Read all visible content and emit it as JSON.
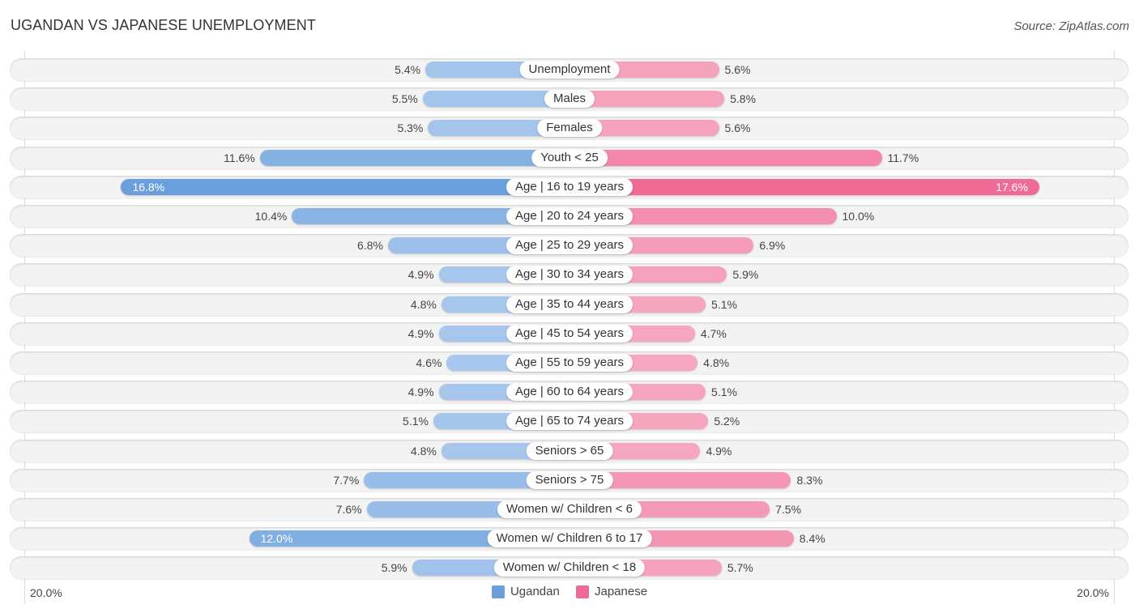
{
  "header": {
    "title": "UGANDAN VS JAPANESE UNEMPLOYMENT",
    "source": "Source: ZipAtlas.com"
  },
  "colors": {
    "ugandan_strong": "#6a9fdb",
    "ugandan_light": "#a8c7ec",
    "japanese_strong": "#f06a96",
    "japanese_light": "#f6a8c0"
  },
  "chart_data": {
    "type": "bar",
    "orientation": "horizontal-diverging",
    "title": "UGANDAN VS JAPANESE UNEMPLOYMENT",
    "xlim": [
      0,
      20.0
    ],
    "axis_labels": {
      "left": "20.0%",
      "right": "20.0%"
    },
    "legend": {
      "position": "bottom-center",
      "entries": [
        "Ugandan",
        "Japanese"
      ]
    },
    "categories": [
      "Unemployment",
      "Males",
      "Females",
      "Youth < 25",
      "Age | 16 to 19 years",
      "Age | 20 to 24 years",
      "Age | 25 to 29 years",
      "Age | 30 to 34 years",
      "Age | 35 to 44 years",
      "Age | 45 to 54 years",
      "Age | 55 to 59 years",
      "Age | 60 to 64 years",
      "Age | 65 to 74 years",
      "Seniors > 65",
      "Seniors > 75",
      "Women w/ Children < 6",
      "Women w/ Children 6 to 17",
      "Women w/ Children < 18"
    ],
    "series": [
      {
        "name": "Ugandan",
        "values": [
          5.4,
          5.5,
          5.3,
          11.6,
          16.8,
          10.4,
          6.8,
          4.9,
          4.8,
          4.9,
          4.6,
          4.9,
          5.1,
          4.8,
          7.7,
          7.6,
          12.0,
          5.9
        ]
      },
      {
        "name": "Japanese",
        "values": [
          5.6,
          5.8,
          5.6,
          11.7,
          17.6,
          10.0,
          6.9,
          5.9,
          5.1,
          4.7,
          4.8,
          5.1,
          5.2,
          4.9,
          8.3,
          7.5,
          8.4,
          5.7
        ]
      }
    ],
    "value_labels": {
      "Ugandan": [
        "5.4%",
        "5.5%",
        "5.3%",
        "11.6%",
        "16.8%",
        "10.4%",
        "6.8%",
        "4.9%",
        "4.8%",
        "4.9%",
        "4.6%",
        "4.9%",
        "5.1%",
        "4.8%",
        "7.7%",
        "7.6%",
        "12.0%",
        "5.9%"
      ],
      "Japanese": [
        "5.6%",
        "5.8%",
        "5.6%",
        "11.7%",
        "17.6%",
        "10.0%",
        "6.9%",
        "5.9%",
        "5.1%",
        "4.7%",
        "4.8%",
        "5.1%",
        "5.2%",
        "4.9%",
        "8.3%",
        "7.5%",
        "8.4%",
        "5.7%"
      ]
    }
  }
}
